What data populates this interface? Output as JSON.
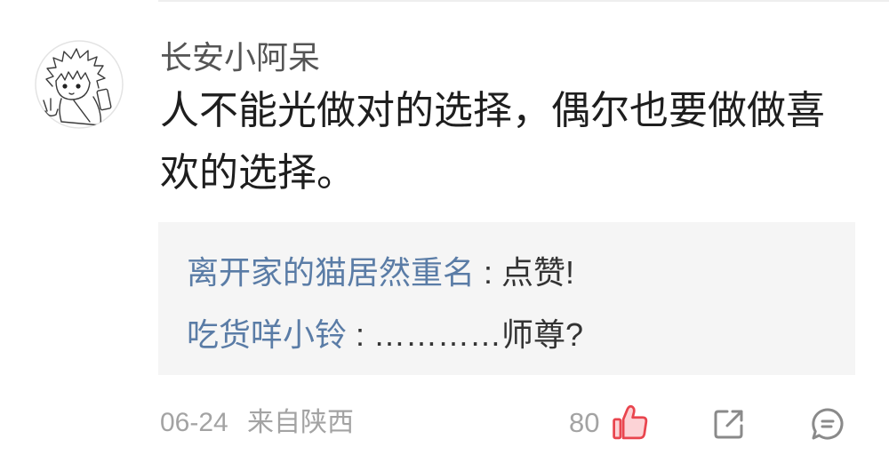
{
  "comment": {
    "username": "长安小阿呆",
    "text": "人不能光做对的选择，偶尔也要做做喜欢的选择。",
    "replies": [
      {
        "name": "离开家的猫居然重名",
        "text": " : 点赞!"
      },
      {
        "name": "吃货咩小铃",
        "text": " : …………师尊?"
      }
    ],
    "date": "06-24",
    "location": "来自陕西",
    "like_count": "80"
  },
  "icons": {
    "avatar": "avatar-icon",
    "like": "thumbs-up-icon",
    "share": "share-icon",
    "comment": "comment-icon"
  },
  "colors": {
    "username": "#555555",
    "text": "#1e1e1e",
    "link": "#5a7ca6",
    "reply_bg": "#f5f5f5",
    "reply_text": "#333333",
    "meta": "#a3a3a3",
    "like_stroke": "#e9454e",
    "like_fill": "#fcd3d6",
    "icon": "#8a8a8a",
    "divider": "#eeeeee"
  }
}
